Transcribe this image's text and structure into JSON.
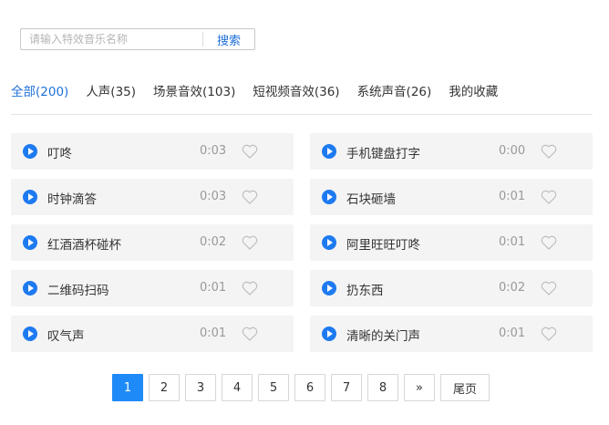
{
  "search": {
    "placeholder": "请输入特效音乐名称",
    "button_label": "搜索"
  },
  "tabs": [
    {
      "label": "全部(200)",
      "active": true
    },
    {
      "label": "人声(35)"
    },
    {
      "label": "场景音效(103)"
    },
    {
      "label": "短视频音效(36)"
    },
    {
      "label": "系统声音(26)"
    },
    {
      "label": "我的收藏"
    }
  ],
  "sounds": [
    {
      "name": "叮咚",
      "duration": "0:03"
    },
    {
      "name": "手机键盘打字",
      "duration": "0:00"
    },
    {
      "name": "时钟滴答",
      "duration": "0:03"
    },
    {
      "name": "石块砸墙",
      "duration": "0:01"
    },
    {
      "name": "红酒酒杯碰杯",
      "duration": "0:02"
    },
    {
      "name": "阿里旺旺叮咚",
      "duration": "0:01"
    },
    {
      "name": "二维码扫码",
      "duration": "0:01"
    },
    {
      "name": "扔东西",
      "duration": "0:02"
    },
    {
      "name": "叹气声",
      "duration": "0:01"
    },
    {
      "name": "清晰的关门声",
      "duration": "0:01"
    }
  ],
  "pagination": {
    "pages": [
      "1",
      "2",
      "3",
      "4",
      "5",
      "6",
      "7",
      "8"
    ],
    "current": "1",
    "next_label": "»",
    "last_label": "尾页"
  },
  "colors": {
    "accent": "#1e7af0",
    "item_bg": "#f4f4f4",
    "duration": "#999999"
  },
  "icons": {
    "play": "play-circle-icon",
    "favorite": "heart-outline-icon"
  }
}
